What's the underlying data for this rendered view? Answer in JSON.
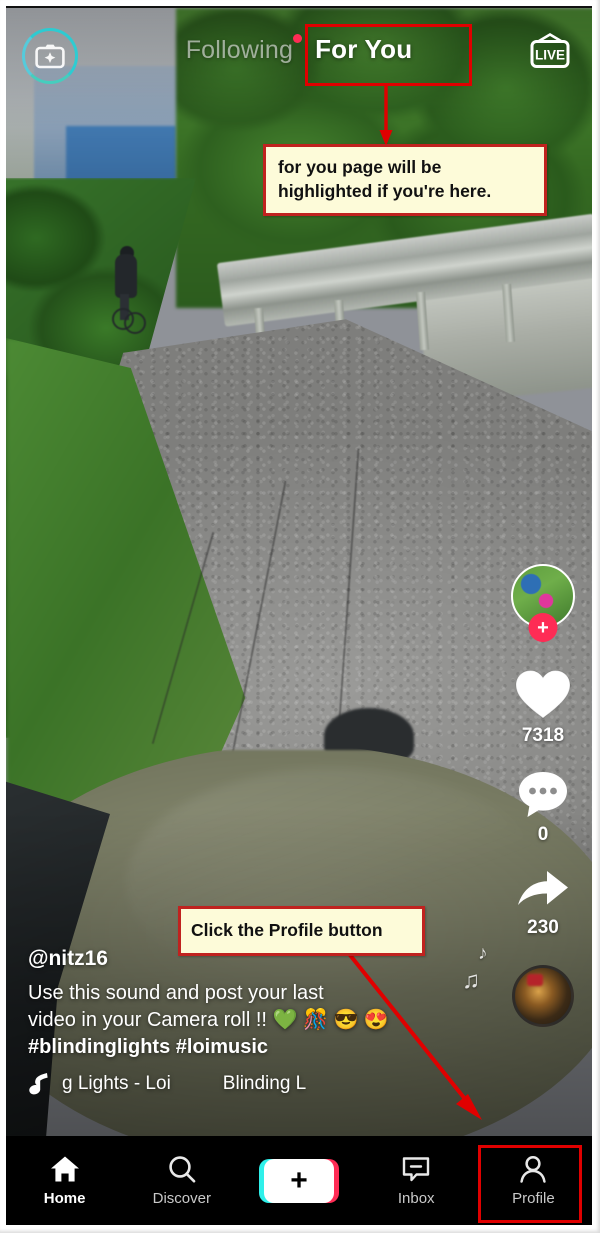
{
  "app": {
    "name": "TikTok"
  },
  "topbar": {
    "camera_icon": "camera-effects-icon",
    "tabs": [
      {
        "id": "following",
        "label": "Following",
        "active": false,
        "has_badge": true
      },
      {
        "id": "foryou",
        "label": "For You",
        "active": true,
        "has_badge": false
      }
    ],
    "live_label": "LIVE"
  },
  "video": {
    "scene": "first-person cycling down a road with a cyclist ahead, guardrail and green foliage",
    "author": "@nitz16",
    "description_line1": "Use this sound and post your last",
    "description_line2": "video in your Camera roll !!",
    "emojis": "💚 🎊 😎 😍",
    "hashtags": "#blindinglights #loimusic",
    "music_note_icon": "music-note-icon",
    "song_marquee_primary": "g Lights - Loi",
    "song_marquee_secondary": "Blinding L"
  },
  "actions": {
    "avatar_name": "creator-avatar",
    "follow_label": "+",
    "like": {
      "icon": "heart-icon",
      "count": "7318"
    },
    "comment": {
      "icon": "comment-bubble-icon",
      "count": "0"
    },
    "share": {
      "icon": "share-arrow-icon",
      "count": "230"
    },
    "music_disc": "spinning-music-disc"
  },
  "bottom_nav": {
    "items": [
      {
        "id": "home",
        "label": "Home",
        "icon": "home-icon",
        "active": true
      },
      {
        "id": "discover",
        "label": "Discover",
        "icon": "search-icon",
        "active": false
      },
      {
        "id": "create",
        "label": "",
        "icon": "plus-icon",
        "active": false
      },
      {
        "id": "inbox",
        "label": "Inbox",
        "icon": "inbox-icon",
        "active": false
      },
      {
        "id": "profile",
        "label": "Profile",
        "icon": "person-icon",
        "active": false
      }
    ]
  },
  "annotations": {
    "callout_foryou": "for you page will be highlighted if you're here.",
    "callout_profile": "Click the  Profile button",
    "highlight_color": "#e00000",
    "callout_bg": "#fdfbd9",
    "callout_border": "#c0221f"
  }
}
